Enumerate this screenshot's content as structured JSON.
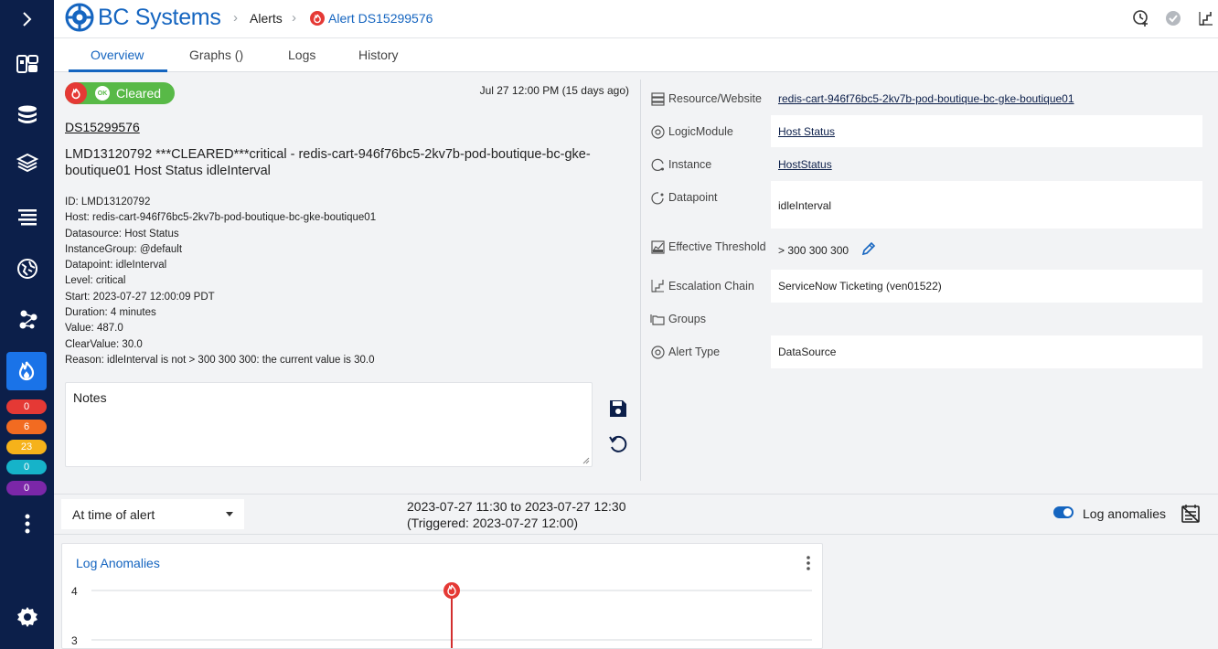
{
  "app": {
    "logo_text": "BC Systems"
  },
  "breadcrumb": {
    "alerts": "Alerts",
    "current": "Alert DS15299576"
  },
  "sidebar": {
    "badges": [
      {
        "value": "0",
        "color": "#e53935"
      },
      {
        "value": "6",
        "color": "#f26b21"
      },
      {
        "value": "23",
        "color": "#f6b21a"
      },
      {
        "value": "0",
        "color": "#16b3c9"
      },
      {
        "value": "0",
        "color": "#7b27a8"
      }
    ]
  },
  "tabs": [
    {
      "label": "Overview",
      "active": true
    },
    {
      "label": "Graphs ()"
    },
    {
      "label": "Logs"
    },
    {
      "label": "History"
    }
  ],
  "alert": {
    "status_ok": "OK",
    "status_label": "Cleared",
    "time": "Jul 27 12:00 PM  (15 days ago)",
    "id_link": "DS15299576",
    "title": "LMD13120792 ***CLEARED***critical - redis-cart-946f76bc5-2kv7b-pod-boutique-bc-gke-boutique01 Host Status idleInterval",
    "details": [
      "ID: LMD13120792",
      "Host: redis-cart-946f76bc5-2kv7b-pod-boutique-bc-gke-boutique01",
      "Datasource: Host Status",
      "InstanceGroup: @default",
      "Datapoint: idleInterval",
      "Level: critical",
      "Start: 2023-07-27 12:00:09 PDT",
      "Duration: 4 minutes",
      "Value: 487.0",
      "ClearValue: 30.0",
      "Reason: idleInterval is not > 300 300 300: the current value is 30.0"
    ],
    "notes_placeholder": "Notes"
  },
  "properties": {
    "resource": {
      "label": "Resource/Website",
      "value": "redis-cart-946f76bc5-2kv7b-pod-boutique-bc-gke-boutique01"
    },
    "logicmodule": {
      "label": "LogicModule",
      "value": "Host Status"
    },
    "instance": {
      "label": "Instance",
      "value": "HostStatus"
    },
    "datapoint": {
      "label": "Datapoint",
      "value": "idleInterval"
    },
    "threshold": {
      "label": "Effective Threshold",
      "value": "> 300 300 300"
    },
    "escalation": {
      "label": "Escalation Chain",
      "value": "ServiceNow Ticketing (ven01522)"
    },
    "groups": {
      "label": "Groups",
      "value": ""
    },
    "alert_type": {
      "label": "Alert Type",
      "value": "DataSource"
    }
  },
  "filter": {
    "time_select": "At time of alert",
    "range_line1": "2023-07-27 11:30 to 2023-07-27 12:30",
    "range_line2": "(Triggered: 2023-07-27 12:00)",
    "toggle_label": "Log anomalies",
    "toggle_on": true
  },
  "chart_data": {
    "type": "line",
    "title": "Log Anomalies",
    "y_ticks": [
      "4",
      "3"
    ],
    "alert_marker_at": "2023-07-27 12:00",
    "series": []
  }
}
